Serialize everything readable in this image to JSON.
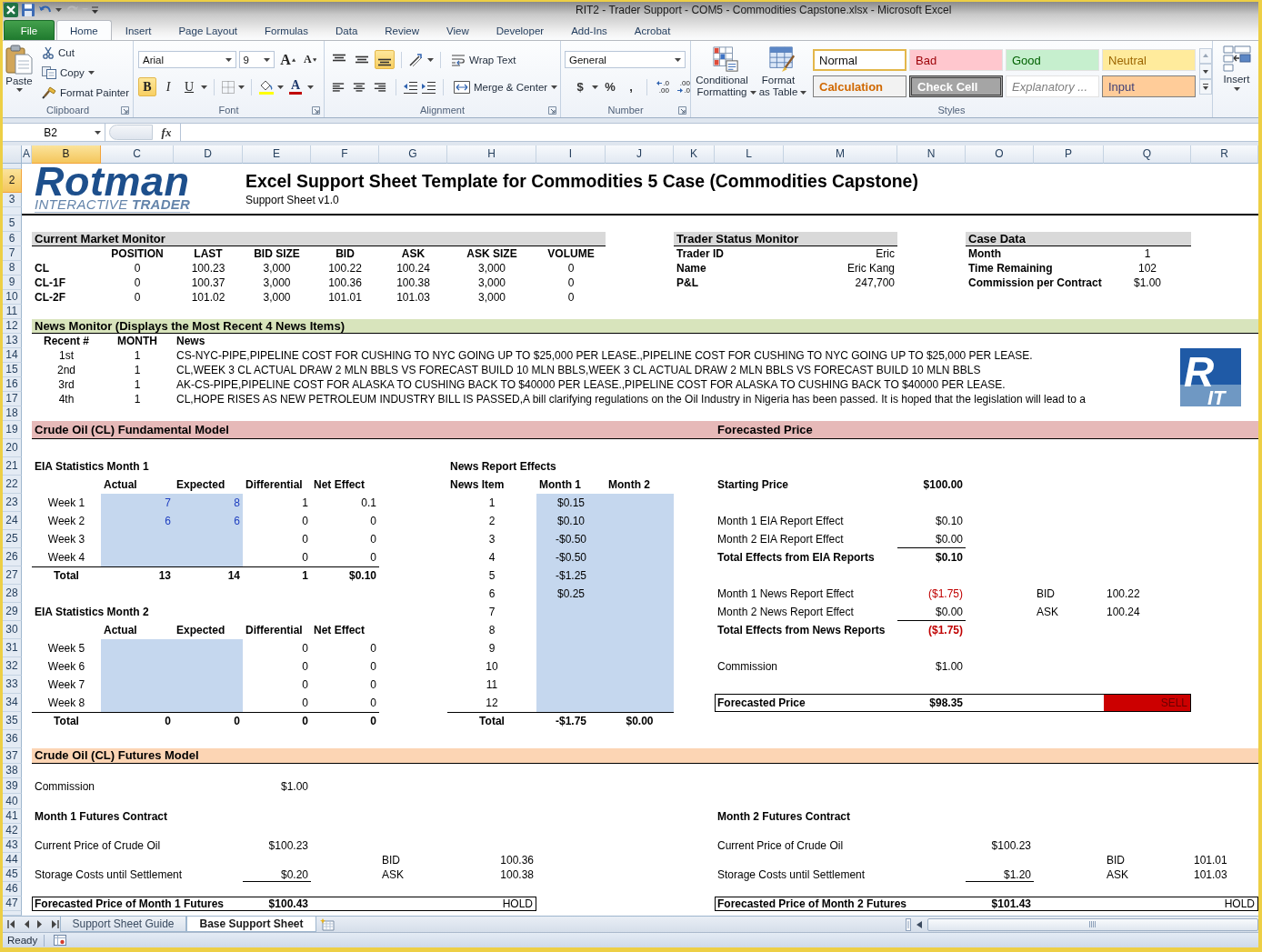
{
  "window": {
    "title": "RIT2 - Trader Support - COM5 - Commodities Capstone.xlsx - Microsoft Excel"
  },
  "quick_access": [
    {
      "kind": "save",
      "disabled": false
    },
    {
      "kind": "undo",
      "disabled": false
    },
    {
      "kind": "redo",
      "disabled": true
    }
  ],
  "ribbon_tabs": [
    {
      "label": "File",
      "kind": "file",
      "selected": false
    },
    {
      "label": "Home",
      "kind": "tab",
      "selected": true
    },
    {
      "label": "Insert",
      "kind": "tab",
      "selected": false
    },
    {
      "label": "Page Layout",
      "kind": "tab",
      "selected": false
    },
    {
      "label": "Formulas",
      "kind": "tab",
      "selected": false
    },
    {
      "label": "Data",
      "kind": "tab",
      "selected": false
    },
    {
      "label": "Review",
      "kind": "tab",
      "selected": false
    },
    {
      "label": "View",
      "kind": "tab",
      "selected": false
    },
    {
      "label": "Developer",
      "kind": "tab",
      "selected": false
    },
    {
      "label": "Add-Ins",
      "kind": "tab",
      "selected": false
    },
    {
      "label": "Acrobat",
      "kind": "tab",
      "selected": false
    }
  ],
  "ribbon": {
    "clipboard": {
      "label": "Clipboard",
      "paste": "Paste",
      "cut": "Cut",
      "copy": "Copy",
      "format_painter": "Format Painter"
    },
    "font": {
      "label": "Font",
      "font_name": "Arial",
      "font_size": "9",
      "grow_font": "A",
      "shrink_font": "A",
      "bold": {
        "label": "B",
        "selected": true
      },
      "italic": {
        "label": "I",
        "selected": false
      },
      "underline": {
        "label": "U",
        "selected": false
      },
      "font_color": "A"
    },
    "alignment": {
      "label": "Alignment",
      "vertical": [
        {
          "kind": "top",
          "selected": false
        },
        {
          "kind": "middle",
          "selected": false
        },
        {
          "kind": "bottom",
          "selected": true
        }
      ],
      "horizontal": [
        {
          "kind": "left",
          "selected": false
        },
        {
          "kind": "center",
          "selected": false
        },
        {
          "kind": "right",
          "selected": false
        }
      ],
      "wrap_text": "Wrap Text",
      "merge_center": "Merge & Center"
    },
    "number": {
      "label": "Number",
      "format": "General",
      "currency": "$",
      "percent": "%",
      "comma": ",",
      "increase_decimal": [
        ".0",
        ".00"
      ],
      "decrease_decimal": [
        ".00",
        ".0"
      ]
    },
    "styles": {
      "label": "Styles",
      "conditional_formatting": "Conditional Formatting",
      "format_as_table": "Format as Table",
      "gallery": [
        {
          "label": "Normal",
          "kind": "normal",
          "selected": true
        },
        {
          "label": "Bad",
          "kind": "bad",
          "selected": false
        },
        {
          "label": "Good",
          "kind": "good",
          "selected": false
        },
        {
          "label": "Neutral",
          "kind": "neutral",
          "selected": false
        },
        {
          "label": "Calculation",
          "kind": "calculation",
          "selected": false
        },
        {
          "label": "Check Cell",
          "kind": "check",
          "selected": false
        },
        {
          "label": "Explanatory ...",
          "kind": "explanatory",
          "selected": false
        },
        {
          "label": "Input",
          "kind": "input",
          "selected": false
        }
      ]
    },
    "cells": {
      "insert": "Insert"
    }
  },
  "formula_bar": {
    "name_box": "B2",
    "function_button": "fx"
  },
  "column_headers": [
    {
      "label": "A",
      "selected": false
    },
    {
      "label": "B",
      "selected": true
    },
    {
      "label": "C",
      "selected": false
    },
    {
      "label": "D",
      "selected": false
    },
    {
      "label": "E",
      "selected": false
    },
    {
      "label": "F",
      "selected": false
    },
    {
      "label": "G",
      "selected": false
    },
    {
      "label": "H",
      "selected": false
    },
    {
      "label": "I",
      "selected": false
    },
    {
      "label": "J",
      "selected": false
    },
    {
      "label": "K",
      "selected": false
    },
    {
      "label": "L",
      "selected": false
    },
    {
      "label": "M",
      "selected": false
    },
    {
      "label": "N",
      "selected": false
    },
    {
      "label": "O",
      "selected": false
    },
    {
      "label": "P",
      "selected": false
    },
    {
      "label": "Q",
      "selected": false
    },
    {
      "label": "R",
      "selected": false
    }
  ],
  "row_headers": [
    {
      "selected": false
    },
    {
      "label": "2",
      "selected": true
    },
    {
      "label": "3",
      "selected": false
    },
    {
      "selected": false
    },
    {
      "label": "5",
      "selected": false
    },
    {
      "label": "6",
      "selected": false
    },
    {
      "label": "7",
      "selected": false
    },
    {
      "label": "8",
      "selected": false
    },
    {
      "label": "9",
      "selected": false
    },
    {
      "label": "10",
      "selected": false
    },
    {
      "label": "11",
      "selected": false
    },
    {
      "label": "12",
      "selected": false
    },
    {
      "label": "13",
      "selected": false
    },
    {
      "label": "14",
      "selected": false
    },
    {
      "label": "15",
      "selected": false
    },
    {
      "label": "16",
      "selected": false
    },
    {
      "label": "17",
      "selected": false
    },
    {
      "label": "18",
      "selected": false
    },
    {
      "label": "19",
      "selected": false
    },
    {
      "label": "20",
      "selected": false
    },
    {
      "label": "21",
      "selected": false
    },
    {
      "label": "22",
      "selected": false
    },
    {
      "label": "23",
      "selected": false
    },
    {
      "label": "24",
      "selected": false
    },
    {
      "label": "25",
      "selected": false
    },
    {
      "label": "26",
      "selected": false
    },
    {
      "label": "27",
      "selected": false
    },
    {
      "label": "28",
      "selected": false
    },
    {
      "label": "29",
      "selected": false
    },
    {
      "label": "30",
      "selected": false
    },
    {
      "label": "31",
      "selected": false
    },
    {
      "label": "32",
      "selected": false
    },
    {
      "label": "33",
      "selected": false
    },
    {
      "label": "34",
      "selected": false
    },
    {
      "label": "35",
      "selected": false
    },
    {
      "label": "36",
      "selected": false
    },
    {
      "label": "37",
      "selected": false
    },
    {
      "label": "38",
      "selected": false
    },
    {
      "label": "39",
      "selected": false
    },
    {
      "label": "40",
      "selected": false
    },
    {
      "label": "41",
      "selected": false
    },
    {
      "label": "42",
      "selected": false
    },
    {
      "label": "43",
      "selected": false
    },
    {
      "label": "44",
      "selected": false
    },
    {
      "label": "45",
      "selected": false
    },
    {
      "label": "46",
      "selected": false
    },
    {
      "label": "47",
      "selected": false
    }
  ],
  "sheet": {
    "logo": {
      "wordmark": "Rotman",
      "tagline": "INTERACTIVE **TRADER**"
    },
    "title": "Excel Support Sheet Template for Commodities 5 Case (Commodities Capstone)",
    "subtitle": "Support Sheet v1.0",
    "market_monitor": {
      "title": "Current Market Monitor",
      "columns": [
        "POSITION",
        "LAST",
        "BID SIZE",
        "BID",
        "ASK",
        "ASK SIZE",
        "VOLUME"
      ],
      "rows": [
        {
          "ticker": "CL",
          "values": [
            "0",
            "100.23",
            "3,000",
            "100.22",
            "100.24",
            "3,000",
            "0"
          ]
        },
        {
          "ticker": "CL-1F",
          "values": [
            "0",
            "100.37",
            "3,000",
            "100.36",
            "100.38",
            "3,000",
            "0"
          ]
        },
        {
          "ticker": "CL-2F",
          "values": [
            "0",
            "101.02",
            "3,000",
            "101.01",
            "101.03",
            "3,000",
            "0"
          ]
        }
      ]
    },
    "trader_status": {
      "title": "Trader Status Monitor",
      "rows": [
        {
          "label": "Trader ID",
          "value": "Eric"
        },
        {
          "label": "Name",
          "value": "Eric Kang"
        },
        {
          "label": "P&L",
          "value": "247,700"
        }
      ]
    },
    "case_data": {
      "title": "Case Data",
      "rows": [
        {
          "label": "Month",
          "value": "1"
        },
        {
          "label": "Time Remaining",
          "value": "102"
        },
        {
          "label": "Commission per Contract",
          "value": "$1.00"
        }
      ]
    },
    "news_monitor": {
      "title": "News Monitor (Displays the Most Recent 4 News Items)",
      "columns": [
        "Recent #",
        "MONTH",
        "News"
      ],
      "rows": [
        {
          "recent": "1st",
          "month": "1",
          "news": "CS-NYC-PIPE,PIPELINE COST FOR CUSHING TO NYC GOING UP TO $25,000 PER LEASE.,PIPELINE COST FOR CUSHING TO NYC GOING UP TO $25,000 PER LEASE."
        },
        {
          "recent": "2nd",
          "month": "1",
          "news": "CL,WEEK 3 CL ACTUAL DRAW 2 MLN BBLS VS FORECAST BUILD 10 MLN BBLS,WEEK 3 CL ACTUAL DRAW 2 MLN BBLS VS FORECAST BUILD 10 MLN BBLS"
        },
        {
          "recent": "3rd",
          "month": "1",
          "news": "AK-CS-PIPE,PIPELINE COST FOR ALASKA TO CUSHING BACK TO $40000 PER LEASE.,PIPELINE COST FOR ALASKA TO CUSHING BACK TO $40000 PER LEASE."
        },
        {
          "recent": "4th",
          "month": "1",
          "news": "CL,HOPE RISES AS NEW PETROLEUM INDUSTRY BILL IS PASSED,A bill clarifying regulations on the Oil Industry in Nigeria has been passed. It is hoped that the legislation will lead to a"
        }
      ],
      "rit_logo": {
        "top": "R",
        "bottom": "IT"
      }
    },
    "fundamental_model": {
      "title": "Crude Oil (CL) Fundamental Model",
      "forecast_title": "Forecasted Price",
      "eia": [
        {
          "title": "EIA Statistics Month 1",
          "columns": [
            "Actual",
            "Expected",
            "Differential",
            "Net Effect"
          ],
          "rows": [
            {
              "week": "Week 1",
              "actual": "7",
              "expected": "8",
              "differential": "1",
              "net_effect": "0.1"
            },
            {
              "week": "Week 2",
              "actual": "6",
              "expected": "6",
              "differential": "0",
              "net_effect": "0"
            },
            {
              "week": "Week 3",
              "differential": "0",
              "net_effect": "0"
            },
            {
              "week": "Week 4",
              "differential": "0",
              "net_effect": "0"
            }
          ],
          "total": {
            "label": "Total",
            "actual": "13",
            "expected": "14",
            "differential": "1",
            "net_effect": "$0.10"
          }
        },
        {
          "title": "EIA Statistics Month 2",
          "columns": [
            "Actual",
            "Expected",
            "Differential",
            "Net Effect"
          ],
          "rows": [
            {
              "week": "Week 5",
              "differential": "0",
              "net_effect": "0"
            },
            {
              "week": "Week 6",
              "differential": "0",
              "net_effect": "0"
            },
            {
              "week": "Week 7",
              "differential": "0",
              "net_effect": "0"
            },
            {
              "week": "Week 8",
              "differential": "0",
              "net_effect": "0"
            }
          ],
          "total": {
            "label": "Total",
            "actual": "0",
            "expected": "0",
            "differential": "0",
            "net_effect": "0"
          }
        }
      ],
      "news_effects": {
        "title": "News Report Effects",
        "columns": [
          "News Item",
          "Month 1",
          "Month 2"
        ],
        "rows": [
          {
            "item": "1",
            "month_1": "$0.15"
          },
          {
            "item": "2",
            "month_1": "$0.10"
          },
          {
            "item": "3",
            "month_1": "-$0.50"
          },
          {
            "item": "4",
            "month_1": "-$0.50"
          },
          {
            "item": "5",
            "month_1": "-$1.25"
          },
          {
            "item": "6",
            "month_1": "$0.25"
          },
          {
            "item": "7"
          },
          {
            "item": "8"
          },
          {
            "item": "9"
          },
          {
            "item": "10"
          },
          {
            "item": "11"
          },
          {
            "item": "12"
          }
        ],
        "total": {
          "label": "Total",
          "month_1": "-$1.75",
          "month_2": "$0.00"
        }
      },
      "forecast": {
        "groups": [
          [
            {
              "label": "Starting Price",
              "value": "$100.00",
              "kind": "total",
              "negative": false
            }
          ],
          [
            {
              "label": "Month 1 EIA Report Effect",
              "value": "$0.10",
              "kind": "item",
              "negative": false
            },
            {
              "label": "Month 2 EIA Report Effect",
              "value": "$0.00",
              "kind": "ruled",
              "negative": false
            },
            {
              "label": "Total Effects from EIA Reports",
              "value": "$0.10",
              "kind": "total",
              "negative": false
            }
          ],
          [
            {
              "label": "Month 1 News Report Effect",
              "value": "($1.75)",
              "kind": "item",
              "negative": true,
              "quote": {
                "label": "BID",
                "value": "100.22"
              }
            },
            {
              "label": "Month 2 News Report Effect",
              "value": "$0.00",
              "kind": "ruled",
              "negative": false,
              "quote": {
                "label": "ASK",
                "value": "100.24"
              }
            },
            {
              "label": "Total Effects from News Reports",
              "value": "($1.75)",
              "kind": "total",
              "negative": true
            }
          ],
          [
            {
              "label": "Commission",
              "value": "$1.00",
              "kind": "item",
              "negative": false
            }
          ]
        ],
        "result": {
          "label": "Forecasted Price",
          "value": "$98.35",
          "signal": {
            "label": "SELL",
            "kind": "sell"
          }
        }
      }
    },
    "futures_model": {
      "title": "Crude Oil (CL) Futures Model",
      "commission": {
        "label": "Commission",
        "value": "$1.00"
      },
      "contracts": [
        {
          "title": "Month 1 Futures Contract",
          "price_label": "Current Price of Crude Oil",
          "price": "$100.23",
          "bid_label": "BID",
          "bid": "100.36",
          "storage_label": "Storage Costs until Settlement",
          "storage": "$0.20",
          "ask_label": "ASK",
          "ask": "100.38",
          "result_label": "Forecasted Price of Month 1 Futures",
          "result": "$100.43",
          "signal": {
            "label": "HOLD",
            "kind": "hold"
          }
        },
        {
          "title": "Month 2 Futures Contract",
          "price_label": "Current Price of Crude Oil",
          "price": "$100.23",
          "bid_label": "BID",
          "bid": "101.01",
          "storage_label": "Storage Costs until Settlement",
          "storage": "$1.20",
          "ask_label": "ASK",
          "ask": "101.03",
          "result_label": "Forecasted Price of Month 2 Futures",
          "result": "$101.43",
          "signal": {
            "label": "HOLD",
            "kind": "hold"
          }
        }
      ]
    }
  },
  "sheet_tabs": [
    {
      "label": "Support Sheet Guide",
      "selected": false
    },
    {
      "label": "Base Support Sheet",
      "selected": true
    }
  ],
  "status_bar": {
    "text": "Ready"
  }
}
